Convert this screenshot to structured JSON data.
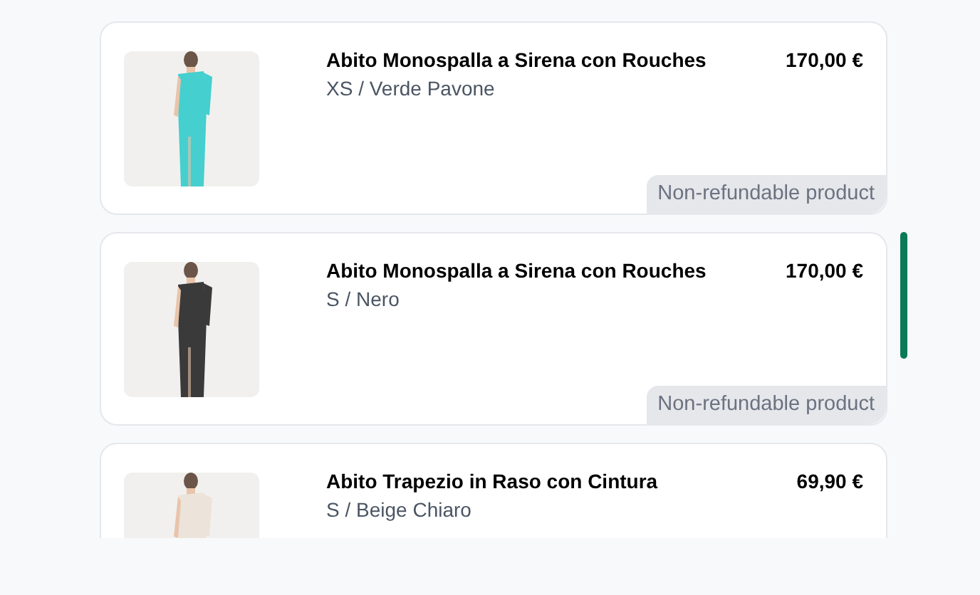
{
  "items": [
    {
      "name": "Abito Monospalla a Sirena con Rouches",
      "variant": "XS / Verde Pavone",
      "price": "170,00 €",
      "badge": "Non-refundable product"
    },
    {
      "name": "Abito Monospalla a Sirena con Rouches",
      "variant": "S / Nero",
      "price": "170,00 €",
      "badge": "Non-refundable product"
    },
    {
      "name": "Abito Trapezio in Raso con Cintura",
      "variant": "S / Beige Chiaro",
      "price": "69,90 €"
    }
  ]
}
